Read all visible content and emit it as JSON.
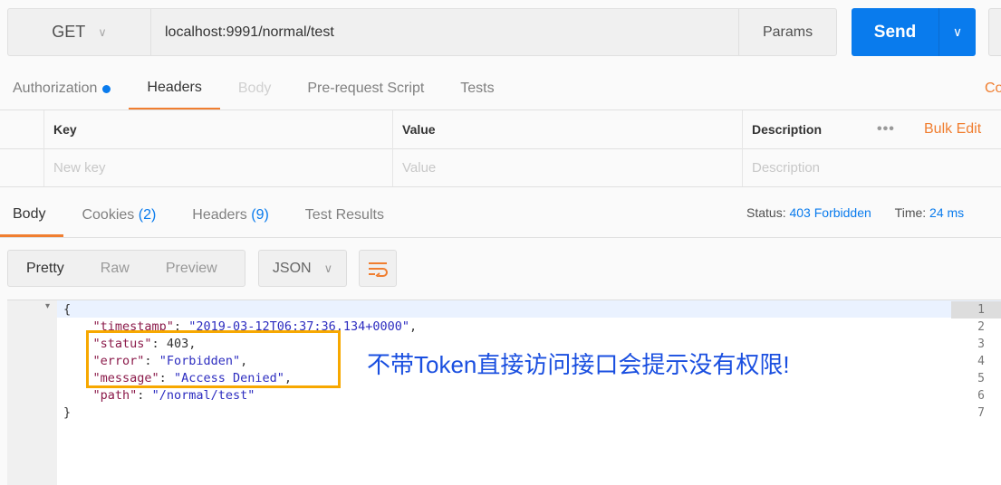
{
  "request": {
    "method": "GET",
    "url": "localhost:9991/normal/test",
    "params_label": "Params",
    "send_label": "Send"
  },
  "request_tabs": [
    {
      "label": "Authorization"
    },
    {
      "label": "Headers"
    },
    {
      "label": "Body"
    },
    {
      "label": "Pre-request Script"
    },
    {
      "label": "Tests"
    }
  ],
  "cookies_link": "Co",
  "headers_table": {
    "columns": [
      "Key",
      "Value",
      "Description"
    ],
    "bulk_edit": "Bulk Edit",
    "placeholders": [
      "New key",
      "Value",
      "Description"
    ]
  },
  "response_tabs": [
    {
      "label": "Body"
    },
    {
      "label": "Cookies",
      "count": "(2)"
    },
    {
      "label": "Headers",
      "count": "(9)"
    },
    {
      "label": "Test Results"
    }
  ],
  "response_status": {
    "status_label": "Status:",
    "status": "403 Forbidden",
    "time_label": "Time:",
    "time": "24 ms"
  },
  "view_modes": [
    "Pretty",
    "Raw",
    "Preview"
  ],
  "format": "JSON",
  "code_lines": [
    {
      "num": "1",
      "parts": [
        [
          "p",
          "{"
        ]
      ]
    },
    {
      "num": "2",
      "parts": [
        [
          "p",
          "    "
        ],
        [
          "k",
          "\"timestamp\""
        ],
        [
          "p",
          ": "
        ],
        [
          "v",
          "\"2019-03-12T06:37:36.134+0000\""
        ],
        [
          "p",
          ","
        ]
      ]
    },
    {
      "num": "3",
      "parts": [
        [
          "p",
          "    "
        ],
        [
          "k",
          "\"status\""
        ],
        [
          "p",
          ": "
        ],
        [
          "n",
          "403"
        ],
        [
          "p",
          ","
        ]
      ]
    },
    {
      "num": "4",
      "parts": [
        [
          "p",
          "    "
        ],
        [
          "k",
          "\"error\""
        ],
        [
          "p",
          ": "
        ],
        [
          "v",
          "\"Forbidden\""
        ],
        [
          "p",
          ","
        ]
      ]
    },
    {
      "num": "5",
      "parts": [
        [
          "p",
          "    "
        ],
        [
          "k",
          "\"message\""
        ],
        [
          "p",
          ": "
        ],
        [
          "v",
          "\"Access Denied\""
        ],
        [
          "p",
          ","
        ]
      ]
    },
    {
      "num": "6",
      "parts": [
        [
          "p",
          "    "
        ],
        [
          "k",
          "\"path\""
        ],
        [
          "p",
          ": "
        ],
        [
          "v",
          "\"/normal/test\""
        ]
      ]
    },
    {
      "num": "7",
      "parts": [
        [
          "p",
          "}"
        ]
      ]
    }
  ],
  "annotation": "不带Token直接访问接口会提示没有权限!",
  "colors": {
    "accent": "#097bed",
    "tab_underline": "#f07e30",
    "highlight_box": "#f7a800",
    "annotation": "#1a4fe0"
  }
}
